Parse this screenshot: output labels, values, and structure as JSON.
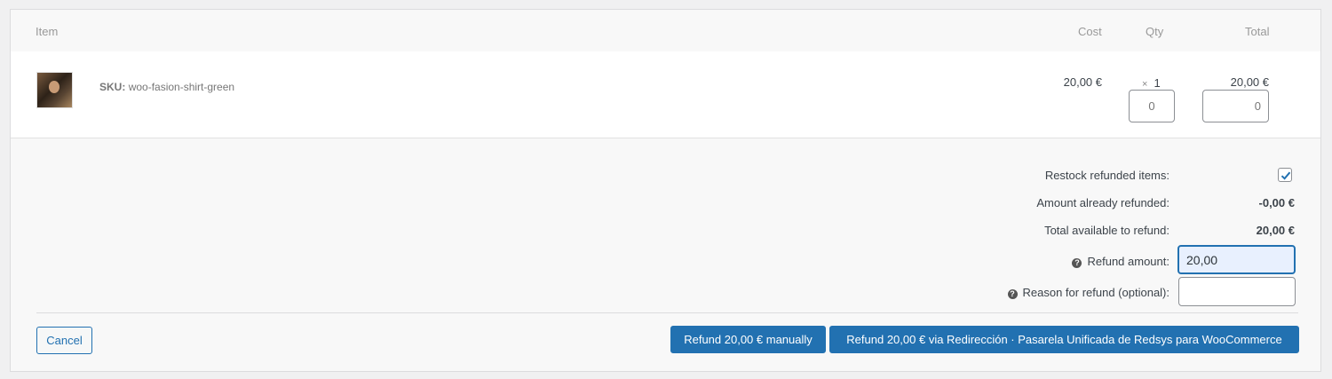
{
  "table": {
    "headers": {
      "item": "Item",
      "cost": "Cost",
      "qty": "Qty",
      "total": "Total"
    },
    "line_item": {
      "sku_label": "SKU:",
      "sku_value": "woo-fasion-shirt-green",
      "cost": "20,00 €",
      "qty_symbol": "×",
      "qty": "1",
      "total": "20,00 €",
      "refund_qty_value": "0",
      "refund_total_value": "0"
    }
  },
  "summary": {
    "restock_label": "Restock refunded items:",
    "restock_checked": true,
    "already_refunded_label": "Amount already refunded:",
    "already_refunded_value": "-0,00 €",
    "available_label": "Total available to refund:",
    "available_value": "20,00 €",
    "refund_amount_label": "Refund amount:",
    "refund_amount_value": "20,00",
    "reason_label": "Reason for refund (optional):",
    "reason_value": ""
  },
  "actions": {
    "cancel": "Cancel",
    "refund_manual": "Refund 20,00 € manually",
    "refund_gateway": "Refund 20,00 € via Redirección · Pasarela Unificada de Redsys para WooCommerce"
  },
  "colors": {
    "primary": "#2271b1",
    "background": "#f0f0f1"
  }
}
